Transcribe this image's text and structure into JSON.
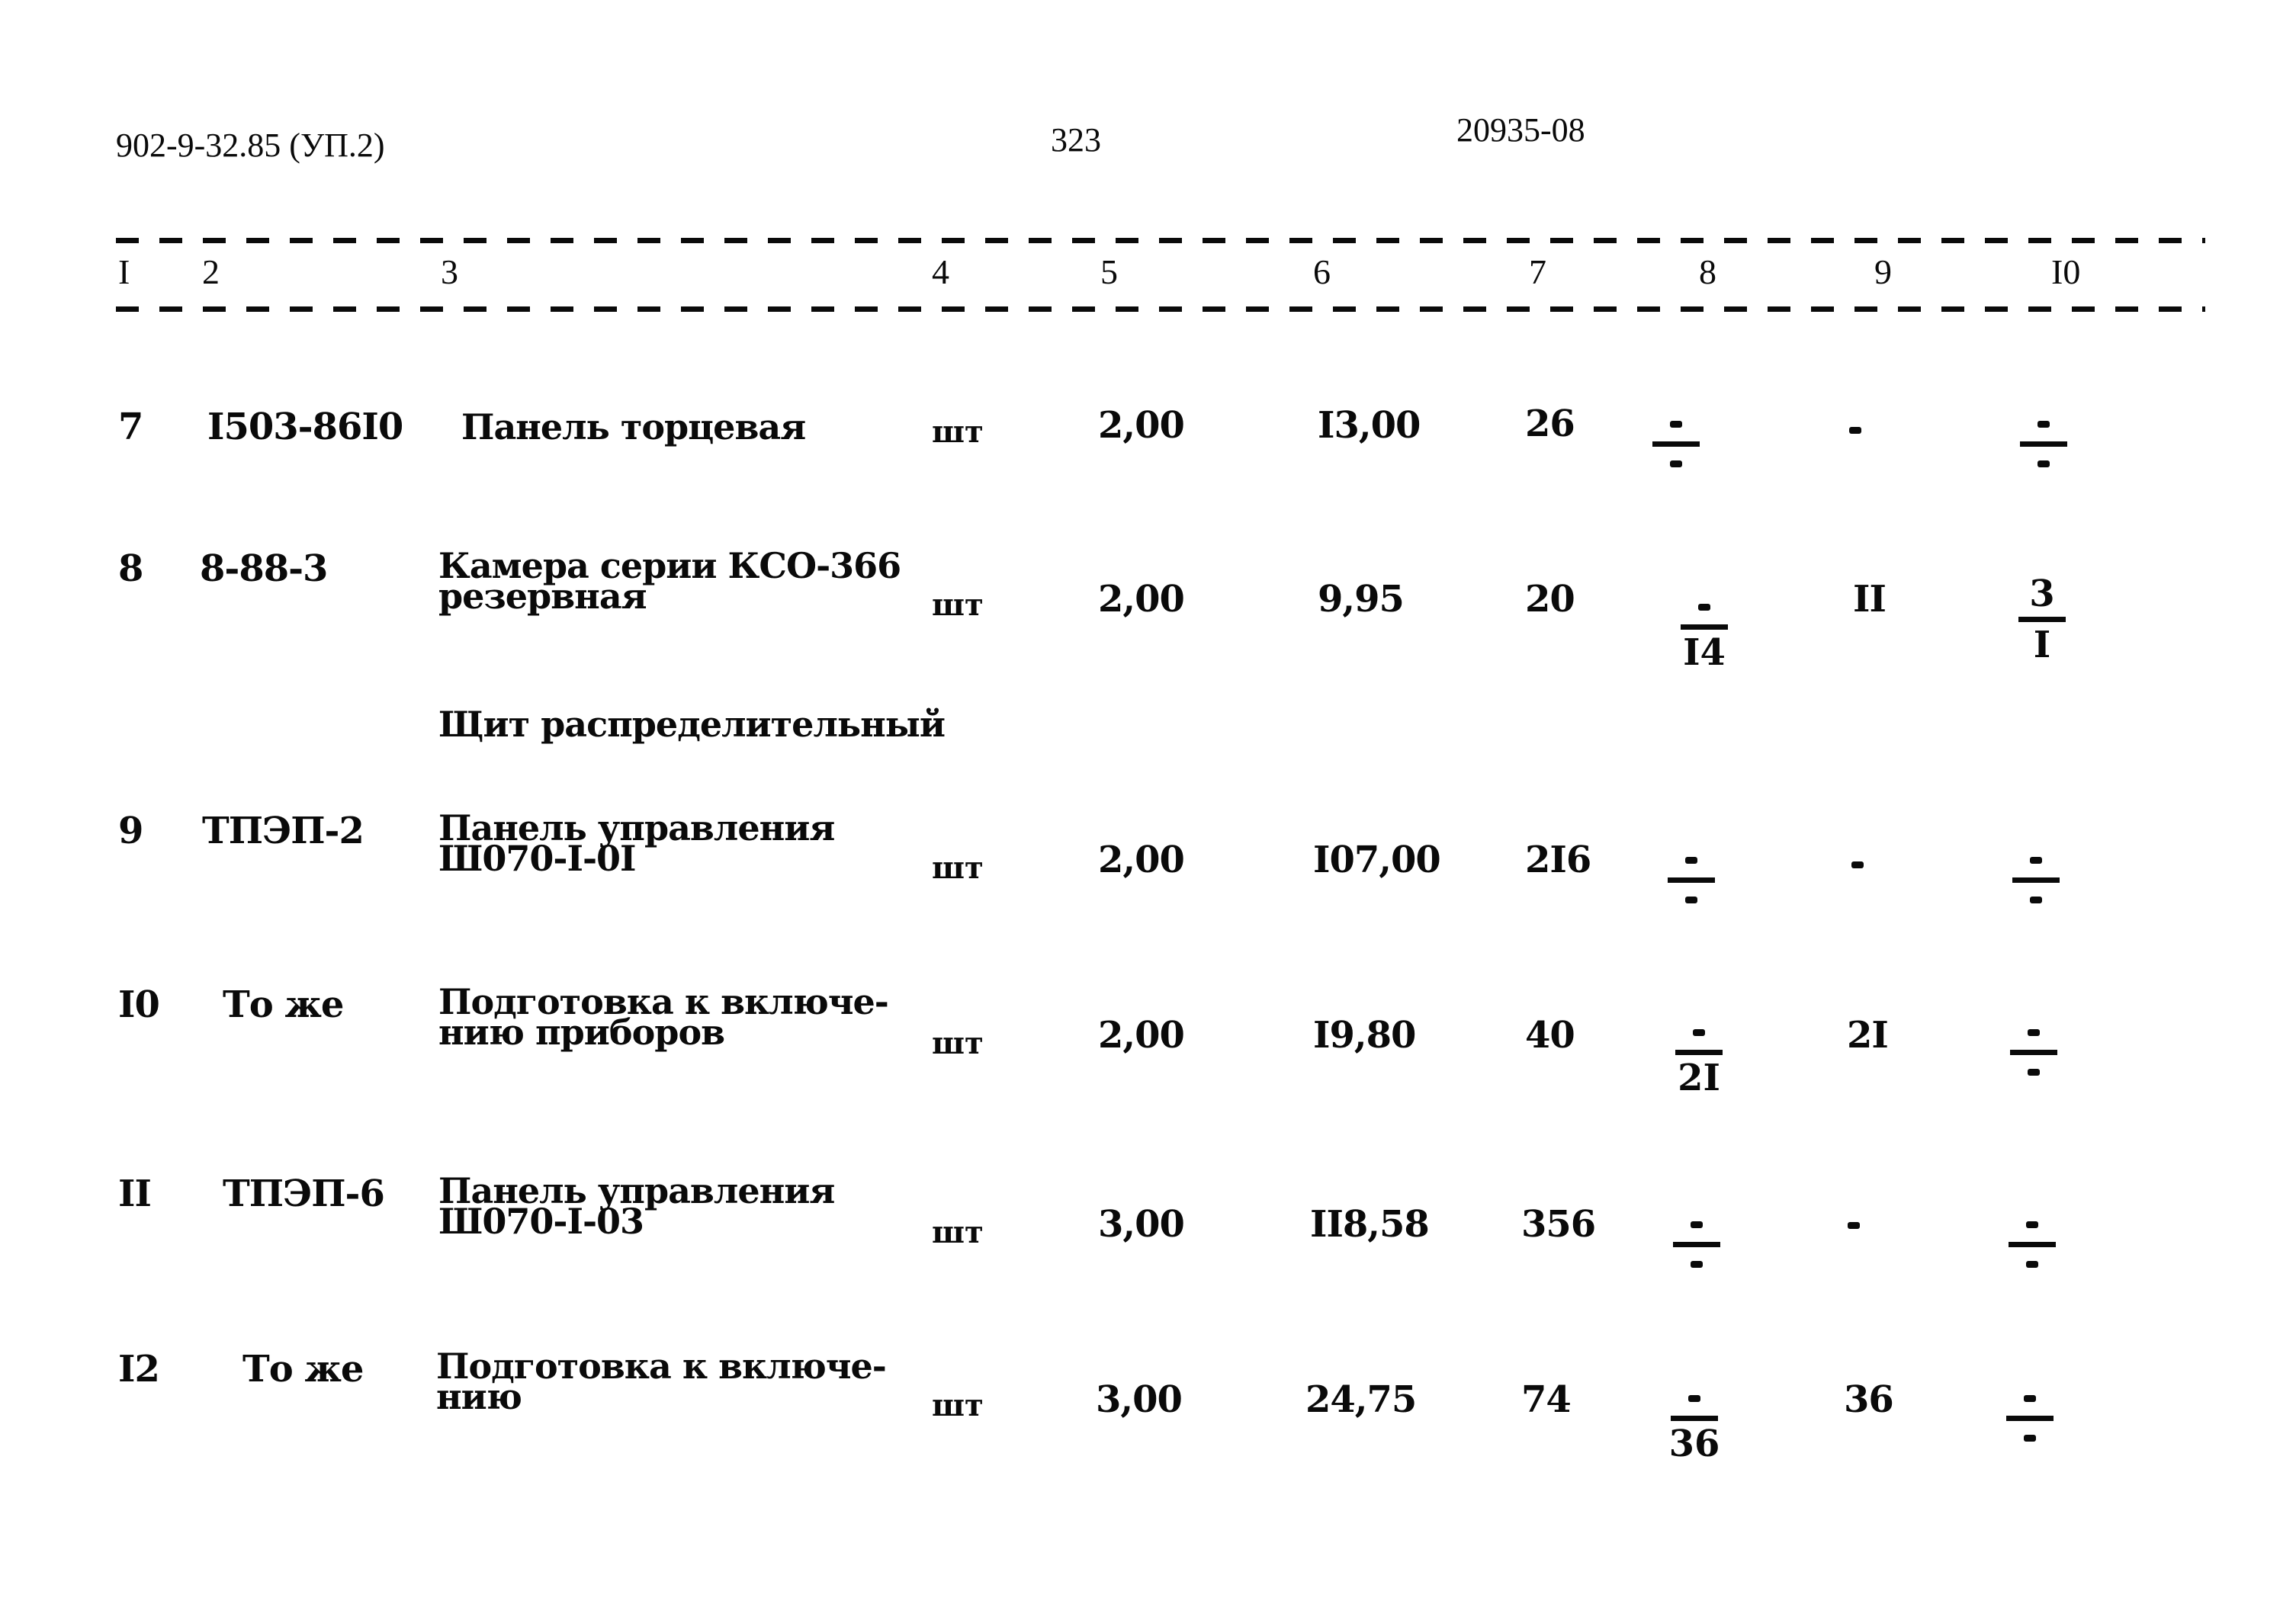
{
  "header": {
    "doc_code": "902-9-32.85 (УП.2)",
    "page_number": "323",
    "inventory_number": "20935-08"
  },
  "columns": [
    "I",
    "2",
    "3",
    "4",
    "5",
    "6",
    "7",
    "8",
    "9",
    "I0"
  ],
  "rows": [
    {
      "no": "7",
      "code": "I503-86I0",
      "desc_lines": [
        "Панель торцевая"
      ],
      "unit": "шт",
      "qty": "2,00",
      "price": "I3,00",
      "total": "26",
      "c8": {
        "num": "-",
        "den": "-"
      },
      "c9": "-",
      "c10": {
        "num": "-",
        "den": "-"
      }
    },
    {
      "no": "8",
      "code": "8-88-3",
      "desc_lines": [
        "Камера серии КСО-366",
        "резервная"
      ],
      "unit": "шт",
      "qty": "2,00",
      "price": "9,95",
      "total": "20",
      "c8": {
        "num": "-",
        "den": "I4"
      },
      "c9": "II",
      "c10": {
        "num": "3",
        "den": "I"
      }
    },
    {
      "section_title": "Щит распределительный"
    },
    {
      "no": "9",
      "code": "ТПЭП-2",
      "desc_lines": [
        "Панель управления",
        "Ш070-I-0I"
      ],
      "unit": "шт",
      "qty": "2,00",
      "price": "I07,00",
      "total": "2I6",
      "c8": {
        "num": "-",
        "den": "-"
      },
      "c9": "-",
      "c10": {
        "num": "-",
        "den": "-"
      }
    },
    {
      "no": "I0",
      "code": "То же",
      "desc_lines": [
        "Подготовка к включе-",
        "нию приборов"
      ],
      "unit": "шт",
      "qty": "2,00",
      "price": "I9,80",
      "total": "40",
      "c8": {
        "num": "-",
        "den": "2I"
      },
      "c9": "2I",
      "c10": {
        "num": "-",
        "den": "-"
      }
    },
    {
      "no": "II",
      "code": "ТПЭП-6",
      "desc_lines": [
        "Панель управления",
        "Ш070-I-03"
      ],
      "unit": "шт",
      "qty": "3,00",
      "price": "II8,58",
      "total": "356",
      "c8": {
        "num": "-",
        "den": "-"
      },
      "c9": "-",
      "c10": {
        "num": "-",
        "den": "-"
      }
    },
    {
      "no": "I2",
      "code": "То же",
      "desc_lines": [
        "Подготовка к включе-",
        "нию"
      ],
      "unit": "шт",
      "qty": "3,00",
      "price": "24,75",
      "total": "74",
      "c8": {
        "num": "-",
        "den": "36"
      },
      "c9": "36",
      "c10": {
        "num": "-",
        "den": "-"
      }
    }
  ]
}
